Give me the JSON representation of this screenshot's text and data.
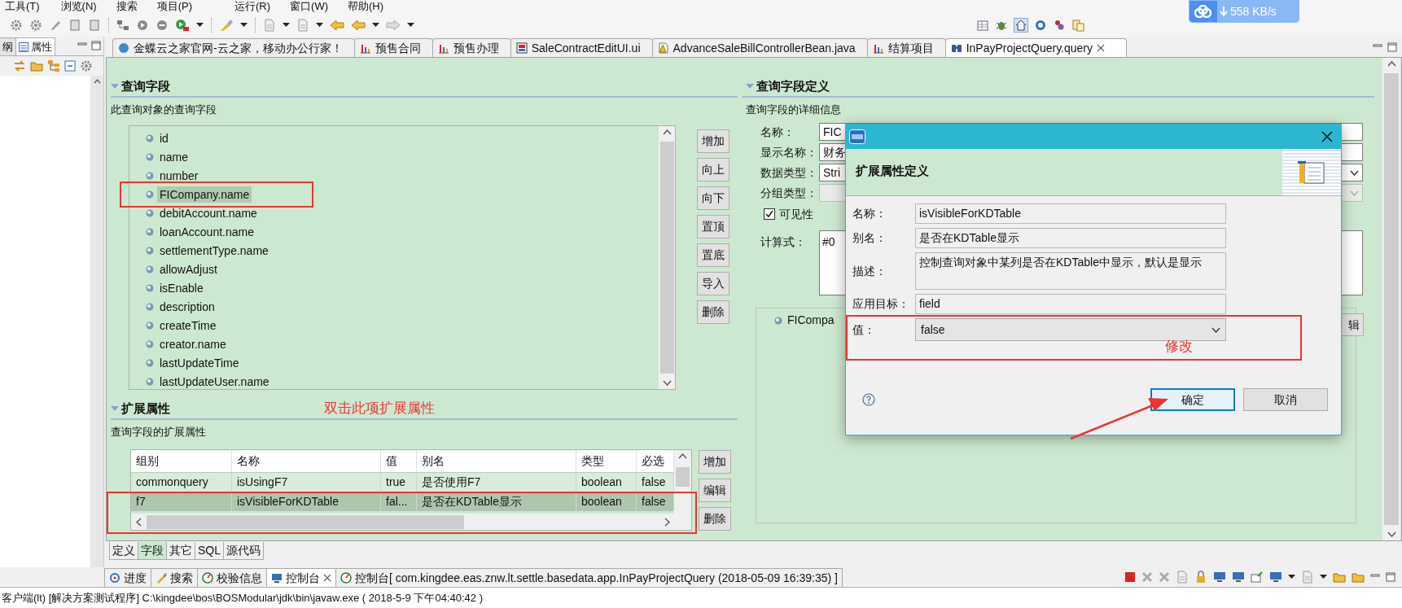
{
  "menu_bar": [
    "工具(T)",
    "浏览(N)",
    "搜索",
    "项目(P)",
    "运行(R)",
    "窗口(W)",
    "帮助(H)"
  ],
  "network_speed": "558 KB/s",
  "left_panel": {
    "tabs": [
      {
        "label": "纲",
        "selected": false
      },
      {
        "label": "属性",
        "selected": true
      }
    ]
  },
  "editor_tabs": [
    {
      "label": "金蝶云之家官网-云之家，移动办公行家！",
      "kind": "web",
      "selected": false
    },
    {
      "label": "预售合同",
      "kind": "chart",
      "selected": false
    },
    {
      "label": "预售办理",
      "kind": "chart",
      "selected": false
    },
    {
      "label": "SaleContractEditUI.ui",
      "kind": "ui",
      "selected": false
    },
    {
      "label": "AdvanceSaleBillControllerBean.java",
      "kind": "java",
      "selected": false
    },
    {
      "label": "结算项目",
      "kind": "chart",
      "selected": false
    },
    {
      "label": "InPayProjectQuery.query",
      "kind": "query",
      "selected": true
    }
  ],
  "query_fields": {
    "title": "查询字段",
    "subtitle": "此查询对象的查询字段",
    "items": [
      {
        "label": "id",
        "selected": false
      },
      {
        "label": "name",
        "selected": false
      },
      {
        "label": "number",
        "selected": false
      },
      {
        "label": "FICompany.name",
        "selected": true
      },
      {
        "label": "debitAccount.name",
        "selected": false
      },
      {
        "label": "loanAccount.name",
        "selected": false
      },
      {
        "label": "settlementType.name",
        "selected": false
      },
      {
        "label": "allowAdjust",
        "selected": false
      },
      {
        "label": "isEnable",
        "selected": false
      },
      {
        "label": "description",
        "selected": false
      },
      {
        "label": "createTime",
        "selected": false
      },
      {
        "label": "creator.name",
        "selected": false
      },
      {
        "label": "lastUpdateTime",
        "selected": false
      },
      {
        "label": "lastUpdateUser.name",
        "selected": false
      }
    ],
    "buttons": [
      "增加",
      "向上",
      "向下",
      "置顶",
      "置底",
      "导入",
      "删除"
    ]
  },
  "extended_properties": {
    "title": "扩展属性",
    "annotation": "双击此项扩展属性",
    "subtitle": "查询字段的扩展属性",
    "columns": [
      "组别",
      "名称",
      "值",
      "别名",
      "类型",
      "必选"
    ],
    "rows": [
      {
        "cells": [
          "commonquery",
          "isUsingF7",
          "true",
          "是否使用F7",
          "boolean",
          "false"
        ],
        "selected": false
      },
      {
        "cells": [
          "f7",
          "isVisibleForKDTable",
          "fal...",
          "是否在KDTable显示",
          "boolean",
          "false"
        ],
        "selected": true
      }
    ],
    "buttons": [
      "增加",
      "编辑",
      "删除"
    ]
  },
  "field_definition": {
    "title": "查询字段定义",
    "subtitle": "查询字段的详细信息",
    "form": [
      {
        "label": "名称：",
        "value": "FIC",
        "kind": "text",
        "disabled": false
      },
      {
        "label": "显示名称：",
        "value": "财务",
        "kind": "text",
        "disabled": false
      },
      {
        "label": "数据类型：",
        "value": "Stri",
        "kind": "select",
        "disabled": false
      },
      {
        "label": "分组类型：",
        "kind": "select",
        "disabled": true
      }
    ],
    "visible": {
      "label": "可见性",
      "checked": true
    },
    "formula": {
      "label": "计算式：",
      "value": "#0"
    },
    "tree_item": "FICompa",
    "edit_button": "辑"
  },
  "bottom_tabs": [
    {
      "label": "定义",
      "selected": false
    },
    {
      "label": "字段",
      "selected": true
    },
    {
      "label": "其它",
      "selected": false
    },
    {
      "label": "SQL",
      "selected": false
    },
    {
      "label": "源代码",
      "selected": false
    }
  ],
  "dialog": {
    "header": "扩展属性定义",
    "fields": [
      {
        "label": "名称：",
        "value": "isVisibleForKDTable",
        "kind": "text"
      },
      {
        "label": "别名：",
        "value": "是否在KDTable显示",
        "kind": "text"
      },
      {
        "label": "描述：",
        "value": "控制查询对象中某列是否在KDTable中显示，默认是显示",
        "kind": "multiline"
      },
      {
        "label": "应用目标：",
        "value": "field",
        "kind": "text"
      },
      {
        "label": "值：",
        "value": "false",
        "kind": "select"
      }
    ],
    "annotation": "修改",
    "buttons": [
      {
        "label": "确定",
        "default": true
      },
      {
        "label": "取消",
        "default": false
      }
    ]
  },
  "console": {
    "tabs": [
      {
        "label": "进度",
        "kind": "progress",
        "selected": false
      },
      {
        "label": "搜索",
        "kind": "search",
        "selected": false
      },
      {
        "label": "校验信息",
        "kind": "check",
        "selected": false
      },
      {
        "label": "控制台",
        "kind": "console",
        "selected": true
      },
      {
        "label": "控制台[  com.kingdee.eas.znw.lt.settle.basedata.app.InPayProjectQuery (2018-05-09 16:39:35) ]",
        "kind": "check",
        "selected": false
      }
    ],
    "status": "客户端(lt) [解决方案测试程序] C:\\kingdee\\bos\\BOSModular\\jdk\\bin\\javaw.exe ( 2018-5-9 下午04:40:42 )"
  }
}
